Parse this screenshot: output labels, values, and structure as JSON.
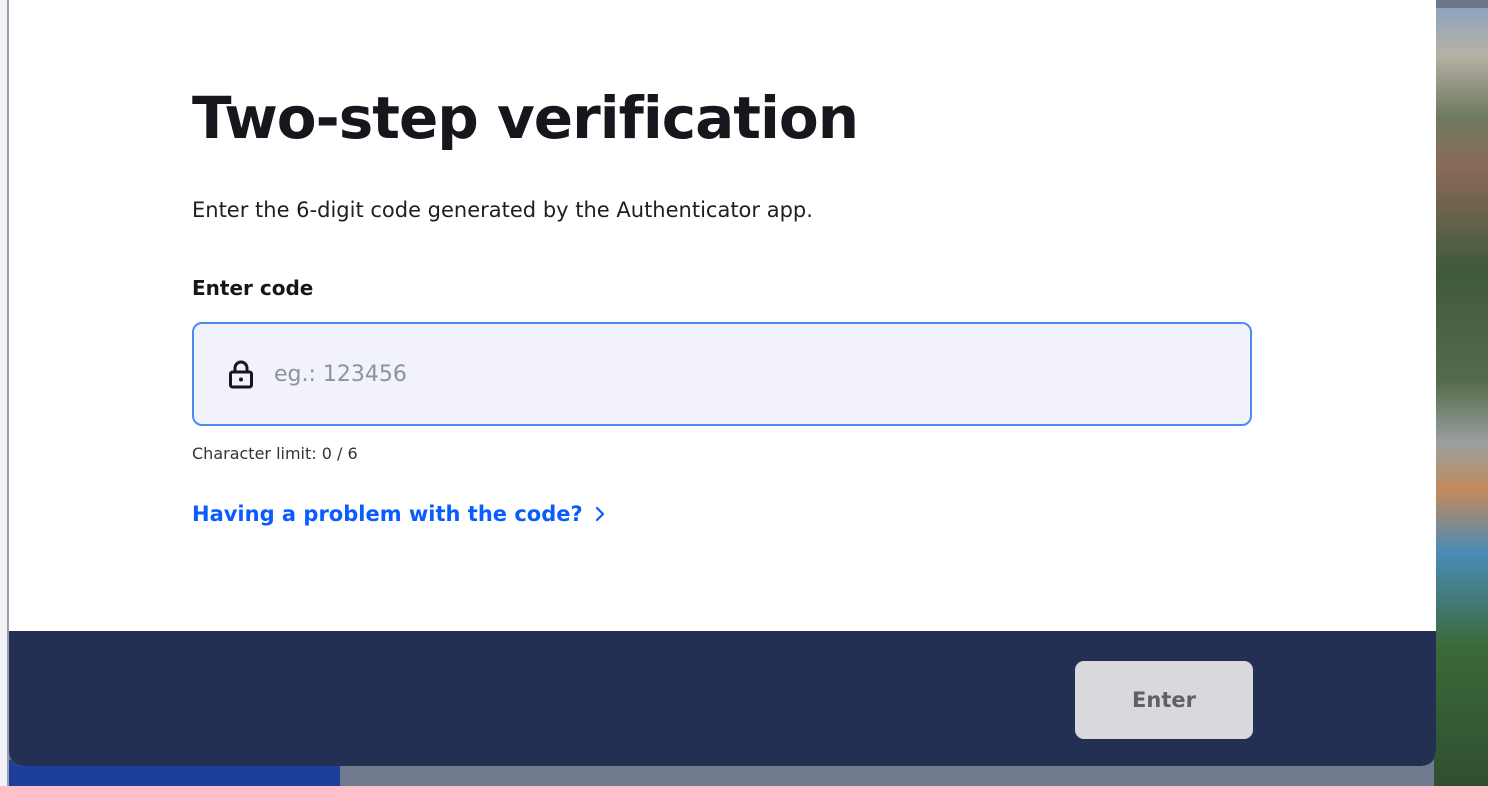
{
  "dialog": {
    "title": "Two-step verification",
    "subtitle": "Enter the 6-digit code generated by the Authenticator app.",
    "field_label": "Enter code",
    "input": {
      "value": "",
      "placeholder": "eg.: 123456",
      "icon": "lock-icon"
    },
    "char_limit_prefix": "Character limit:",
    "char_count": "0 / 6",
    "problem_link": "Having a problem with the code?",
    "enter_button": "Enter"
  },
  "colors": {
    "link": "#0b5cff",
    "input_border": "#4d8bf0",
    "footer_bg": "#233054",
    "button_disabled_bg": "#d9d9dd"
  }
}
